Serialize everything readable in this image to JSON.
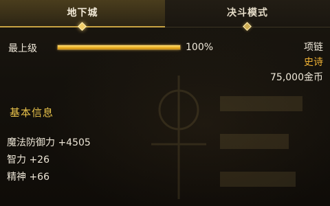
{
  "tabs": [
    {
      "label": "地下城",
      "active": true
    },
    {
      "label": "决斗模式",
      "active": false
    }
  ],
  "level": {
    "label": "最上级",
    "percent_text": "100%",
    "progress": 1.0
  },
  "item": {
    "type": "项链",
    "rarity": "史诗",
    "price": "75,000金币"
  },
  "basic_info": {
    "title": "基本信息",
    "stats": [
      "魔法防御力 +4505",
      "智力 +26",
      "精神 +66"
    ]
  },
  "colors": {
    "accent_gold": "#e8c24a",
    "rarity_epic": "#f0b234",
    "bar_fill": "#f0b52a",
    "background": "#14110c"
  }
}
